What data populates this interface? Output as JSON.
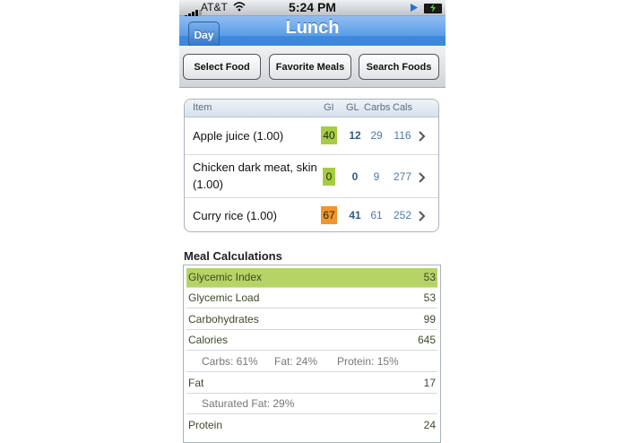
{
  "status": {
    "carrier": "AT&T",
    "time": "5:24 PM"
  },
  "nav": {
    "back_label": "Day",
    "title": "Lunch"
  },
  "toolbar": {
    "select_food": "Select Food",
    "favorite_meals": "Favorite Meals",
    "search_foods": "Search Foods"
  },
  "table": {
    "headers": {
      "item": "Item",
      "gi": "GI",
      "gl": "GL",
      "carbs": "Carbs",
      "cals": "Cals"
    },
    "rows": [
      {
        "name": "Apple juice (1.00)",
        "gi": "40",
        "gi_color": "#a7cc43",
        "gl": "12",
        "carbs": "29",
        "cals": "116"
      },
      {
        "name_line1": "Chicken dark meat, skin",
        "name_line2": "(1.00)",
        "gi": "0",
        "gi_color": "#a7cc43",
        "gl": "0",
        "carbs": "9",
        "cals": "277"
      },
      {
        "name": "Curry rice (1.00)",
        "gi": "67",
        "gi_color": "#f2952a",
        "gl": "41",
        "carbs": "61",
        "cals": "252"
      }
    ]
  },
  "meal": {
    "heading": "Meal Calculations",
    "glycemic_index": {
      "label": "Glycemic Index",
      "value": "53"
    },
    "glycemic_load": {
      "label": "Glycemic Load",
      "value": "53"
    },
    "carbohydrates": {
      "label": "Carbohydrates",
      "value": "99"
    },
    "calories": {
      "label": "Calories",
      "value": "645"
    },
    "breakdown": {
      "carbs": "Carbs: 61%",
      "fat": "Fat: 24%",
      "protein": "Protein: 15%"
    },
    "fat": {
      "label": "Fat",
      "value": "17"
    },
    "saturated_fat": "Saturated Fat: 29%",
    "protein": {
      "label": "Protein",
      "value": "24"
    }
  },
  "colors": {
    "nav_blue": "#3f86d8",
    "gi_low": "#a7cc43",
    "gi_high": "#f2952a",
    "highlight": "#b6d365"
  }
}
